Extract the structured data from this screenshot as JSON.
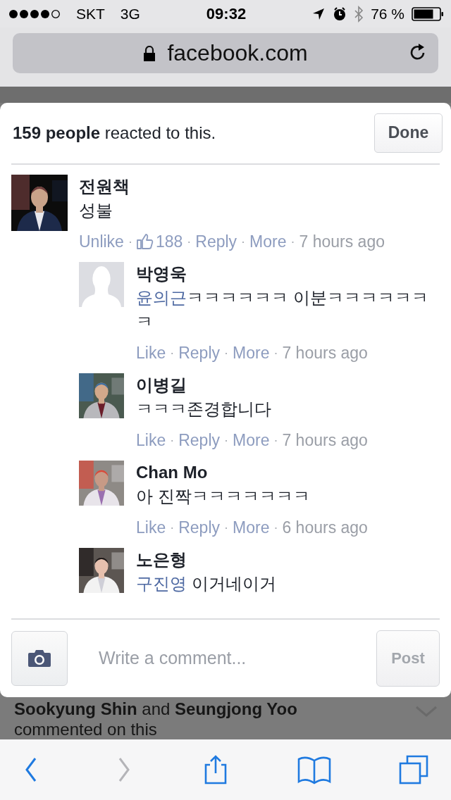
{
  "status_bar": {
    "carrier": "SKT",
    "network": "3G",
    "time": "09:32",
    "battery": "76 %"
  },
  "address_bar": {
    "url": "facebook.com",
    "secure": true
  },
  "sheet": {
    "title": "**159 people** reacted to this.",
    "done_button": "Done",
    "comments": [
      {
        "name": "전원책",
        "avatar": {
          "kind": "picture"
        },
        "text": "성불",
        "actions": [
          {
            "kind": "link",
            "text": "Unlike"
          },
          {
            "kind": "sep",
            "text": "·"
          },
          {
            "kind": "count",
            "text": "188"
          },
          {
            "kind": "sep",
            "text": "·"
          },
          {
            "kind": "link",
            "text": "Reply"
          },
          {
            "kind": "sep",
            "text": "·"
          },
          {
            "kind": "link",
            "text": "More"
          },
          {
            "kind": "sep",
            "text": "·"
          },
          {
            "kind": "time",
            "text": "7 hours ago"
          }
        ],
        "children": [
          {
            "name": "박영욱",
            "avatar": {
              "kind": "default"
            },
            "mention": "윤의근",
            "text": "ㅋㅋㅋㅋㅋㅋ 이분ㅋㅋㅋㅋㅋㅋㅋ",
            "actions": [
              {
                "kind": "link",
                "text": "Like"
              },
              {
                "kind": "sep",
                "text": "·"
              },
              {
                "kind": "link",
                "text": "Reply"
              },
              {
                "kind": "sep",
                "text": "·"
              },
              {
                "kind": "link",
                "text": "More"
              },
              {
                "kind": "sep",
                "text": "·"
              },
              {
                "kind": "time",
                "text": "7 hours ago"
              }
            ]
          },
          {
            "name": "이병길",
            "avatar": {
              "kind": "picture"
            },
            "text": "ㅋㅋㅋ존경합니다",
            "actions": [
              {
                "kind": "link",
                "text": "Like"
              },
              {
                "kind": "sep",
                "text": "·"
              },
              {
                "kind": "link",
                "text": "Reply"
              },
              {
                "kind": "sep",
                "text": "·"
              },
              {
                "kind": "link",
                "text": "More"
              },
              {
                "kind": "sep",
                "text": "·"
              },
              {
                "kind": "time",
                "text": "7 hours ago"
              }
            ]
          },
          {
            "name": "Chan Mo",
            "avatar": {
              "kind": "picture"
            },
            "text": "아 진짝ㅋㅋㅋㅋㅋㅋㅋ",
            "actions": [
              {
                "kind": "link",
                "text": "Like"
              },
              {
                "kind": "sep",
                "text": "·"
              },
              {
                "kind": "link",
                "text": "Reply"
              },
              {
                "kind": "sep",
                "text": "·"
              },
              {
                "kind": "link",
                "text": "More"
              },
              {
                "kind": "sep",
                "text": "·"
              },
              {
                "kind": "time",
                "text": "6 hours ago"
              }
            ]
          },
          {
            "name": "노은형",
            "avatar": {
              "kind": "picture"
            },
            "mention": "구진영",
            "text": " 이거네이거"
          }
        ]
      }
    ],
    "composer": {
      "placeholder": "Write a comment...",
      "post_button": "Post",
      "post_disabled": true
    }
  },
  "background_post": {
    "text": "**Sookyung Shin** and **Seungjong Yoo** commented on this"
  },
  "toolbar": [
    {
      "kind": "back",
      "disabled": false
    },
    {
      "kind": "forward",
      "disabled": true
    },
    {
      "kind": "share",
      "disabled": false
    },
    {
      "kind": "bookmarks",
      "disabled": false
    },
    {
      "kind": "tabs",
      "disabled": false
    }
  ]
}
